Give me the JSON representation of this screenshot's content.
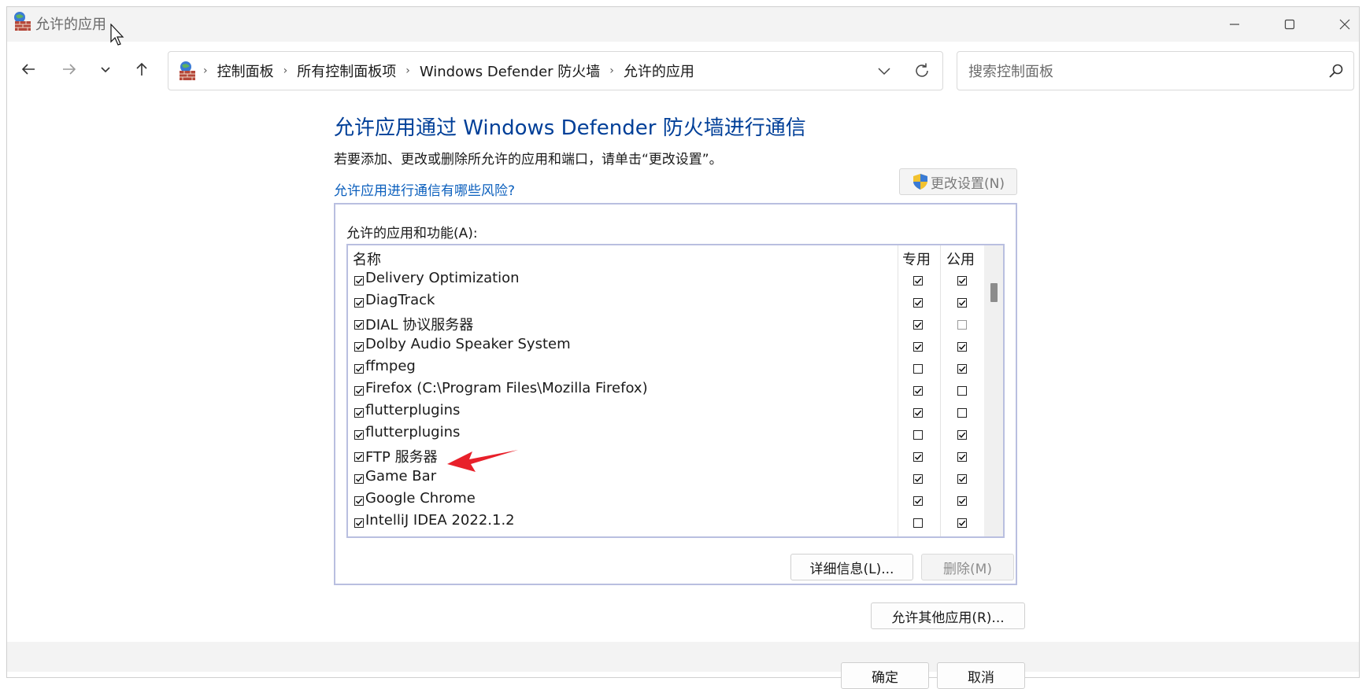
{
  "window": {
    "title": "允许的应用"
  },
  "nav": {
    "breadcrumbs": [
      "控制面板",
      "所有控制面板项",
      "Windows Defender 防火墙",
      "允许的应用"
    ],
    "search_placeholder": "搜索控制面板"
  },
  "main": {
    "heading": "允许应用通过 Windows Defender 防火墙进行通信",
    "description": "若要添加、更改或删除所允许的应用和端口，请单击“更改设置”。",
    "risk_link": "允许应用进行通信有哪些风险?",
    "change_settings_label": "更改设置(N)",
    "group_label": "允许的应用和功能(A):",
    "columns": {
      "name": "名称",
      "private": "专用",
      "public": "公用"
    },
    "apps": [
      {
        "name": "Delivery Optimization",
        "enabled": true,
        "private": true,
        "public": true
      },
      {
        "name": "DiagTrack",
        "enabled": true,
        "private": true,
        "public": true
      },
      {
        "name": "DIAL 协议服务器",
        "enabled": true,
        "private": true,
        "public": false
      },
      {
        "name": "Dolby Audio Speaker System",
        "enabled": true,
        "private": true,
        "public": true
      },
      {
        "name": "ffmpeg",
        "enabled": true,
        "private": false,
        "public": true
      },
      {
        "name": "Firefox (C:\\Program Files\\Mozilla Firefox)",
        "enabled": true,
        "private": true,
        "public": false
      },
      {
        "name": "flutterplugins",
        "enabled": true,
        "private": true,
        "public": false
      },
      {
        "name": "flutterplugins",
        "enabled": true,
        "private": false,
        "public": true
      },
      {
        "name": "FTP 服务器",
        "enabled": true,
        "private": true,
        "public": true
      },
      {
        "name": "Game Bar",
        "enabled": true,
        "private": true,
        "public": true
      },
      {
        "name": "Google Chrome",
        "enabled": true,
        "private": true,
        "public": true
      },
      {
        "name": "IntelliJ IDEA 2022.1.2",
        "enabled": true,
        "private": false,
        "public": true
      }
    ],
    "details_button": "详细信息(L)...",
    "delete_button": "删除(M)",
    "allow_other_button": "允许其他应用(R)..."
  },
  "footer": {
    "ok_button": "确定",
    "cancel_button": "取消"
  },
  "colors": {
    "heading": "#003f98",
    "link": "#0b5fbd",
    "annotation_arrow": "#e8202a"
  }
}
